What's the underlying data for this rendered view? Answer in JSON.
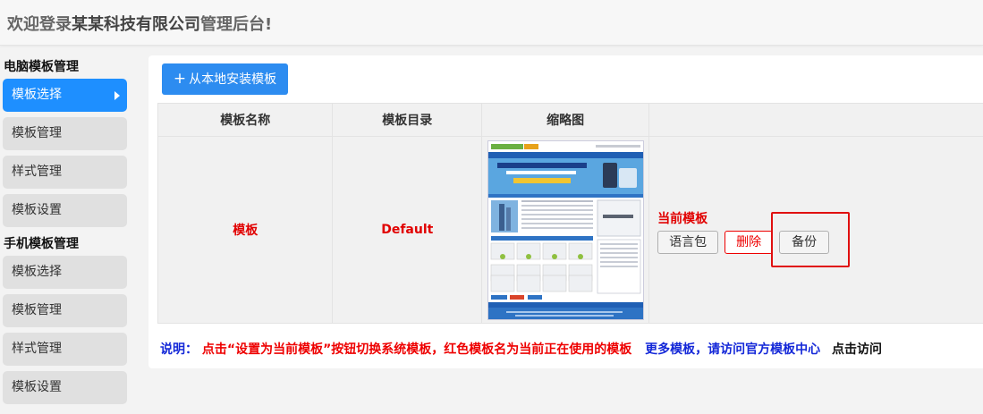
{
  "header": {
    "title_part1": "欢迎登录",
    "title_part2": "某某科技有限公司",
    "title_part3": "管理后台!"
  },
  "sidebar": {
    "pc_group": "电脑模板管理",
    "pc_items": [
      {
        "label": "模板选择",
        "active": true
      },
      {
        "label": "模板管理"
      },
      {
        "label": "样式管理"
      },
      {
        "label": "模板设置"
      }
    ],
    "mobile_group": "手机模板管理",
    "mobile_items": [
      {
        "label": "模板选择"
      },
      {
        "label": "模板管理"
      },
      {
        "label": "样式管理"
      },
      {
        "label": "模板设置"
      }
    ]
  },
  "toolbar": {
    "install_label": "从本地安装模板",
    "install_icon": "plus-icon"
  },
  "table": {
    "headers": [
      "模板名称",
      "模板目录",
      "缩略图",
      ""
    ],
    "rows": [
      {
        "name": "模板",
        "directory": "Default",
        "status": "当前模板",
        "actions": {
          "lang": "语言包",
          "delete": "删除",
          "backup": "备份"
        }
      }
    ]
  },
  "note": {
    "label": "说明：",
    "text1": "点击“设置为当前模板”按钮切换系统模板，红色模板名为当前正在使用的模板",
    "text2": "更多模板，请访问官方模板中心",
    "text3": "点击访问"
  },
  "colors": {
    "accent": "#2d8cf0",
    "sidebar_active": "#1e8fff",
    "danger": "#e10000",
    "link": "#1428d8"
  }
}
